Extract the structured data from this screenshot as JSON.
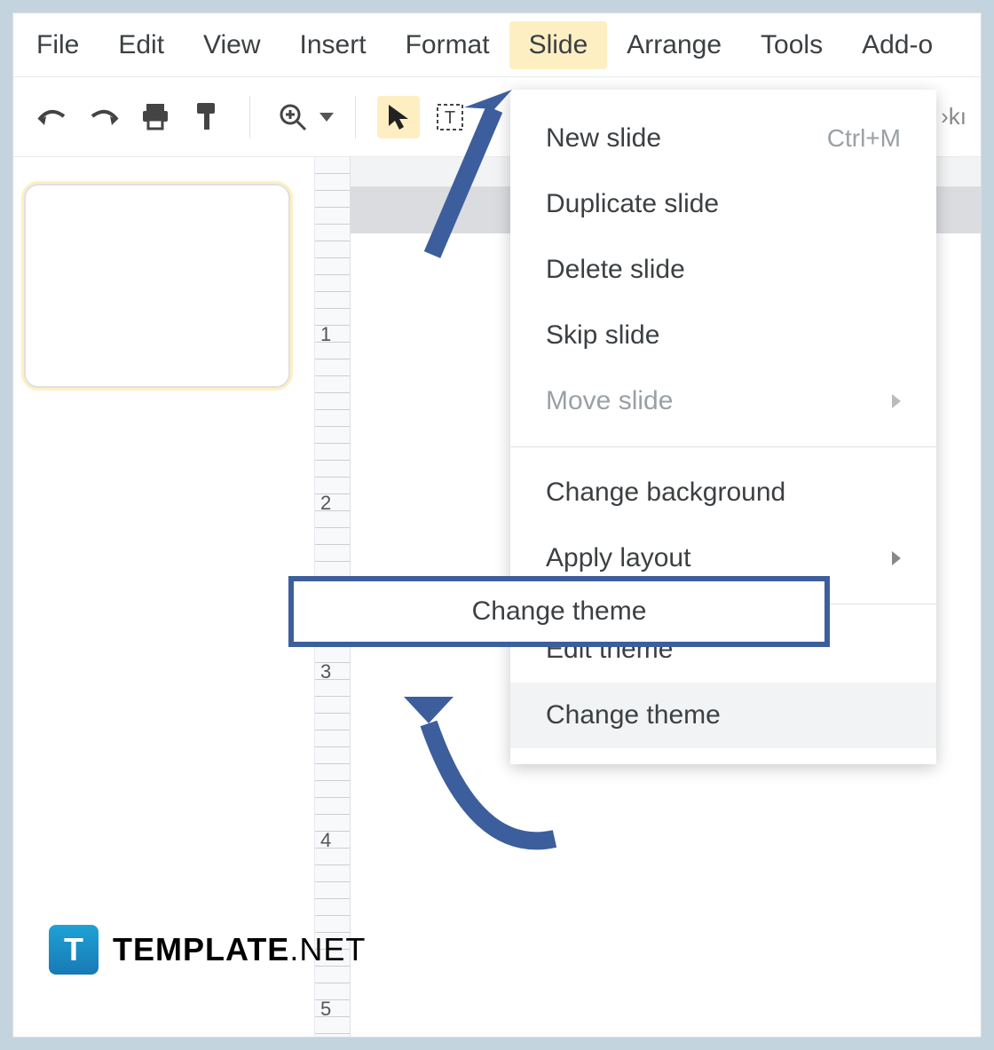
{
  "menubar": {
    "items": [
      "File",
      "Edit",
      "View",
      "Insert",
      "Format",
      "Slide",
      "Arrange",
      "Tools",
      "Add-o"
    ],
    "active_index": 5
  },
  "toolbar": {
    "truncated_text": "›kı"
  },
  "dropdown": {
    "items": [
      {
        "label": "New slide",
        "shortcut": "Ctrl+M",
        "has_submenu": false,
        "disabled": false
      },
      {
        "label": "Duplicate slide",
        "shortcut": "",
        "has_submenu": false,
        "disabled": false
      },
      {
        "label": "Delete slide",
        "shortcut": "",
        "has_submenu": false,
        "disabled": false
      },
      {
        "label": "Skip slide",
        "shortcut": "",
        "has_submenu": false,
        "disabled": false
      },
      {
        "label": "Move slide",
        "shortcut": "",
        "has_submenu": true,
        "disabled": true
      },
      {
        "separator": true
      },
      {
        "label": "Change background",
        "shortcut": "",
        "has_submenu": false,
        "disabled": false
      },
      {
        "label": "Apply layout",
        "shortcut": "",
        "has_submenu": true,
        "disabled": false
      },
      {
        "separator": true
      },
      {
        "label": "Edit theme",
        "shortcut": "",
        "has_submenu": false,
        "disabled": false
      },
      {
        "label": "Change theme",
        "shortcut": "",
        "has_submenu": false,
        "disabled": false,
        "hover": true
      }
    ]
  },
  "ruler_v_labels": [
    "1",
    "2",
    "3",
    "4",
    "5"
  ],
  "callout": {
    "label": "Change theme"
  },
  "watermark": {
    "badge": "T",
    "bold": "TEMPLATE",
    "thin": ".NET"
  },
  "annotation_colors": {
    "arrow": "#3d5e9c",
    "callout_border": "#3d5e9c"
  }
}
